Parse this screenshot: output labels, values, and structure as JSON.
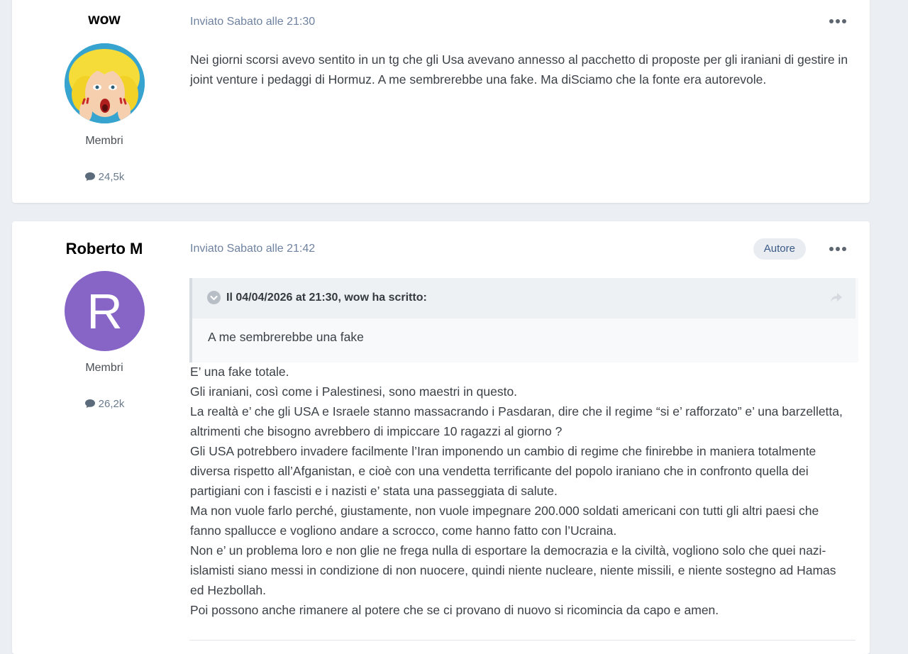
{
  "posts": [
    {
      "author": "wow",
      "role": "Membri",
      "post_count": "24,5k",
      "meta": "Inviato Sabato alle 21:30",
      "body": "Nei giorni scorsi avevo sentito in un tg che gli Usa avevano annesso al pacchetto di proposte per gli iraniani di gestire in joint venture i pedaggi di Hormuz. A me sembrerebbe una fake. Ma diSciamo che la fonte era autorevole."
    },
    {
      "author": "Roberto M",
      "avatar_letter": "R",
      "avatar_color": "#8765c7",
      "role": "Membri",
      "post_count": "26,2k",
      "meta": "Inviato Sabato alle 21:42",
      "badge": "Autore",
      "quote": {
        "header": "Il 04/04/2026 at 21:30, wow ha scritto:",
        "text": "A me sembrerebbe una fake"
      },
      "paragraphs": [
        "E’ una fake totale.",
        "Gli iraniani, così come i Palestinesi, sono maestri in questo.",
        "La realtà e’ che gli USA e Israele stanno massacrando i Pasdaran, dire che il regime “si e’ rafforzato” e’ una barzelletta, altrimenti che bisogno avrebbero di impiccare 10 ragazzi al giorno ?",
        "Gli USA potrebbero invadere facilmente l’Iran imponendo un cambio di regime che finirebbe in maniera totalmente diversa rispetto all’Afganistan, e cioè con una vendetta terrificante del popolo iraniano che in confronto quella dei partigiani con i fascisti e i nazisti e’ stata una passeggiata di salute.",
        "Ma non vuole farlo perché, giustamente, non vuole impegnare 200.000 soldati americani con tutti gli altri paesi che fanno spallucce e vogliono andare a scrocco, come hanno fatto con l’Ucraina.",
        "Non e’ un problema loro e non glie ne frega nulla di esportare la democrazia e la civiltà, vogliono solo che quei nazi-islamisti siano messi in condizione di non nuocere, quindi niente nucleare, niente missili, e niente sostegno ad Hamas ed Hezbollah.",
        "Poi possono anche rimanere al potere che se ci provano di nuovo si ricomincia da capo e amen."
      ]
    }
  ],
  "icons": {
    "post_count": "comment-icon",
    "post_menu": "more-dots-icon",
    "quote_toggle": "chevron-down-circle-icon",
    "quote_share": "share-arrow-icon"
  }
}
